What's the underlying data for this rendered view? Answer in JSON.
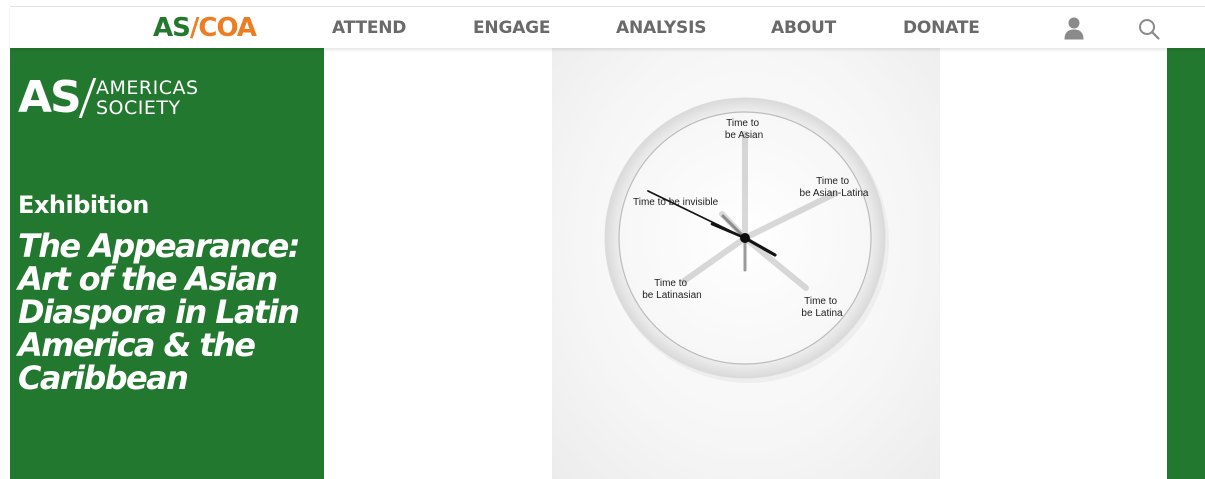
{
  "header": {
    "logo": {
      "as": "AS",
      "slash": "/",
      "coa": "COA"
    },
    "nav": [
      {
        "label": "ATTEND"
      },
      {
        "label": "ENGAGE"
      },
      {
        "label": "ANALYSIS"
      },
      {
        "label": "ABOUT"
      },
      {
        "label": "DONATE"
      }
    ],
    "icons": {
      "account": "user-icon",
      "search": "search-icon"
    }
  },
  "hero": {
    "brand": {
      "mark": "AS",
      "line1": "AMERICAS",
      "line2": "SOCIETY"
    },
    "label": "Exhibition",
    "title_lines": [
      "The Appearance:",
      "Art of the Asian",
      "Diaspora in Latin",
      "America & the",
      "Caribbean"
    ]
  },
  "artwork": {
    "clock_labels": {
      "top": [
        "Time to",
        "be Asian"
      ],
      "right": [
        "Time to",
        "be Asian-Latina"
      ],
      "left": [
        "Time to be invisible"
      ],
      "lower_left": [
        "Time to",
        "be Latinasian"
      ],
      "lower_right": [
        "Time to",
        "be Latina"
      ]
    }
  },
  "colors": {
    "brand_green": "#23782f",
    "brand_orange": "#ed7d22",
    "nav_text": "#6a6a6a"
  }
}
